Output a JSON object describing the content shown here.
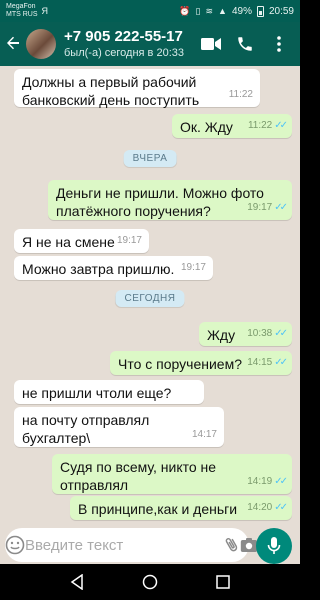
{
  "status_bar": {
    "carrier_1": "MegaFon",
    "carrier_2": "MTS RUS",
    "battery": "49%",
    "time": "20:59"
  },
  "header": {
    "contact_name": "+7 905 222-55-17",
    "last_seen": "был(-а) сегодня в 20:33"
  },
  "messages": [
    {
      "dir": "in",
      "text": "Должны а первый рабочий банковский день поступить",
      "time": "11:22"
    },
    {
      "dir": "out",
      "text": "Ок. Жду",
      "time": "11:22"
    },
    {
      "dir": "out",
      "text": "Деньги не пришли. Можно фото платёжного поручения?",
      "time": "19:17"
    },
    {
      "dir": "in",
      "text": "Я не на смене",
      "time": "19:17"
    },
    {
      "dir": "in",
      "text": "Можно завтра пришлю.",
      "time": "19:17"
    },
    {
      "dir": "out",
      "text": "Жду",
      "time": "10:38"
    },
    {
      "dir": "out",
      "text": "Что с поручением?",
      "time": "14:15"
    },
    {
      "dir": "in",
      "text": "не пришли чтоли еще?",
      "time": "14:17"
    },
    {
      "dir": "in",
      "text": "на почту отправлял бухгалтер\\",
      "time": "14:17"
    },
    {
      "dir": "out",
      "text": "Судя по всему, никто не отправлял",
      "time": "14:19"
    },
    {
      "dir": "out",
      "text": "В принципе,как и деньги",
      "time": "14:20"
    }
  ],
  "date_chips": {
    "yesterday": "ВЧЕРА",
    "today": "СЕГОДНЯ"
  },
  "input": {
    "placeholder": "Введите текст",
    "value": ""
  },
  "colors": {
    "header": "#075e54",
    "outgoing_bubble": "#dcf8c6",
    "incoming_bubble": "#ffffff",
    "chat_background": "#e5ddd5",
    "read_ticks": "#4fc3f7",
    "mic_button": "#00897b"
  },
  "icons": [
    "back-arrow-icon",
    "video-call-icon",
    "phone-icon",
    "menu-icon",
    "emoji-icon",
    "attach-icon",
    "camera-icon",
    "mic-icon",
    "nav-back-icon",
    "nav-home-icon",
    "nav-recents-icon"
  ]
}
